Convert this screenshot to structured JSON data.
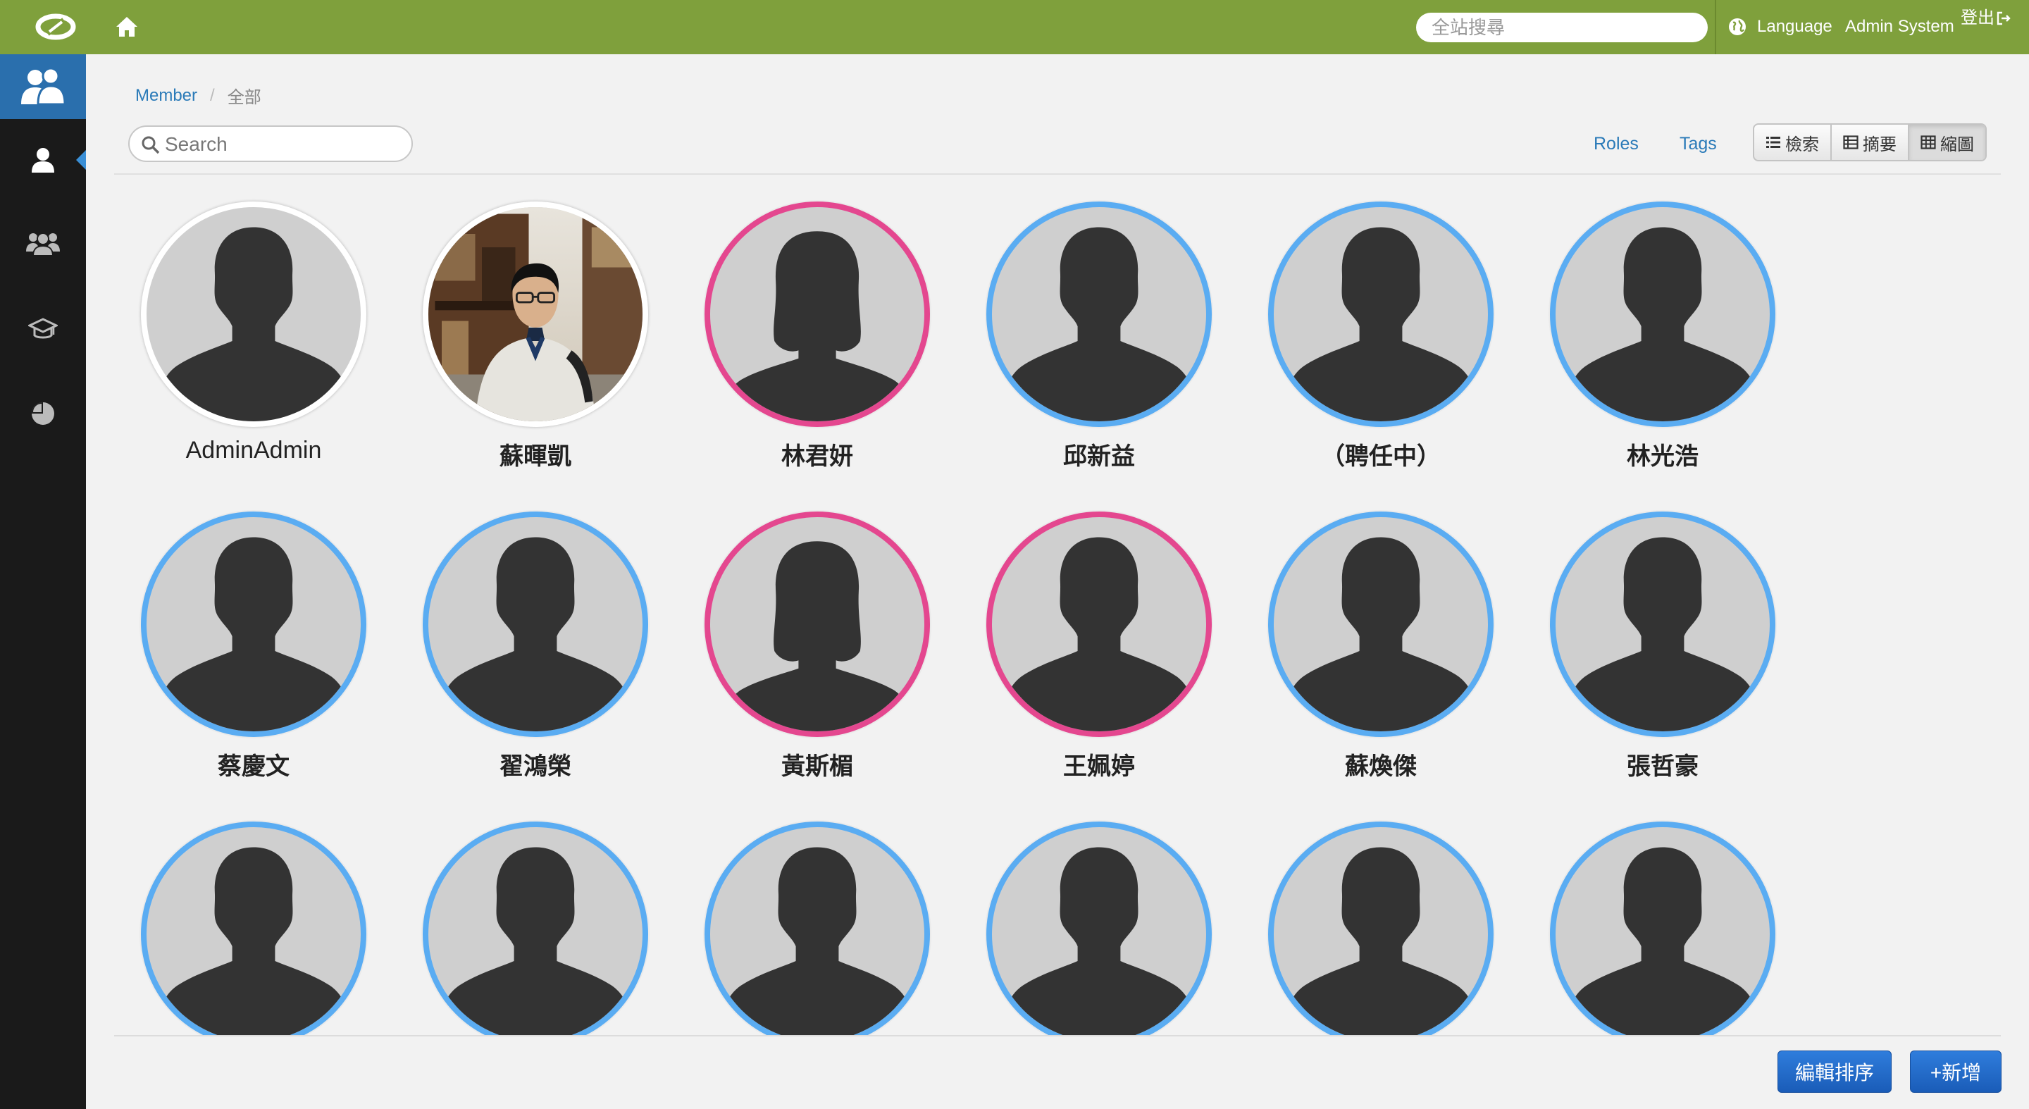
{
  "topbar": {
    "site_search_placeholder": "全站搜尋",
    "language_label": "Language",
    "user_label": "Admin System",
    "logout_label": "登出",
    "background_color": "#7fa03c"
  },
  "sidebar": {
    "items": [
      {
        "icon": "members-icon",
        "active": true
      },
      {
        "icon": "user-icon"
      },
      {
        "icon": "group-icon"
      },
      {
        "icon": "graduation-cap-icon"
      },
      {
        "icon": "pie-chart-icon"
      }
    ]
  },
  "breadcrumb": {
    "root": "Member",
    "current": "全部"
  },
  "search": {
    "placeholder": "Search"
  },
  "filters": {
    "roles": "Roles",
    "tags": "Tags"
  },
  "views": [
    {
      "label": "檢索",
      "icon": "list-icon"
    },
    {
      "label": "摘要",
      "icon": "summary-icon"
    },
    {
      "label": "縮圖",
      "icon": "grid-icon",
      "active": true
    }
  ],
  "members": [
    {
      "name": "AdminAdmin",
      "ring": "white"
    },
    {
      "name": "蘇暉凱",
      "ring": "white",
      "photo": true
    },
    {
      "name": "林君妍",
      "ring": "female"
    },
    {
      "name": "邱新益",
      "ring": "male"
    },
    {
      "name": "（聘任中）",
      "ring": "male"
    },
    {
      "name": "林光浩",
      "ring": "male"
    },
    {
      "name": "蔡慶文",
      "ring": "male"
    },
    {
      "name": "翟鴻榮",
      "ring": "male"
    },
    {
      "name": "黃斯楣",
      "ring": "female"
    },
    {
      "name": "王姵婷",
      "ring": "female",
      "silhouette": "male"
    },
    {
      "name": "蘇煥傑",
      "ring": "male"
    },
    {
      "name": "張哲豪",
      "ring": "male"
    },
    {
      "name": "",
      "ring": "male"
    },
    {
      "name": "",
      "ring": "male"
    },
    {
      "name": "",
      "ring": "male"
    },
    {
      "name": "",
      "ring": "male"
    },
    {
      "name": "",
      "ring": "male"
    },
    {
      "name": "",
      "ring": "male"
    }
  ],
  "actions": {
    "sort_label": "編輯排序",
    "new_label": "+新增"
  },
  "colors": {
    "male_ring": "#5aacf2",
    "female_ring": "#e4478f",
    "primary_button": "#1f66c6"
  }
}
